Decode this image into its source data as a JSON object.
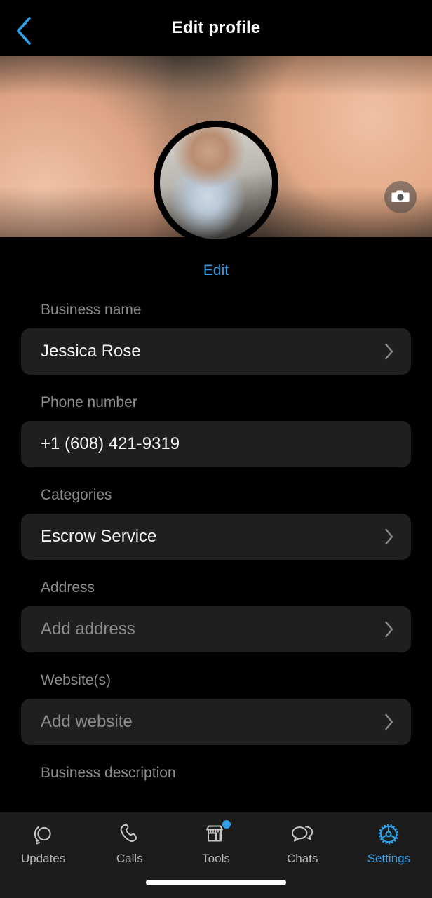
{
  "colors": {
    "accent": "#2f9fe8",
    "background": "#000000",
    "field_background": "#1f1f1f",
    "label_text": "#8d8d8d",
    "value_text": "#f2f2f2",
    "placeholder_text": "#8b8b8b",
    "tabbar_background": "#1c1c1c",
    "tab_inactive": "#b6b6b6",
    "badge": "#2f9fe8"
  },
  "header": {
    "title": "Edit profile",
    "back_icon": "chevron-left-icon"
  },
  "cover": {
    "camera_icon": "camera-icon"
  },
  "profile": {
    "avatar_icon": "avatar-image",
    "edit_label": "Edit"
  },
  "form": {
    "fields": [
      {
        "label": "Business name",
        "value": "Jessica Rose",
        "is_placeholder": false,
        "has_chevron": true,
        "name": "business-name"
      },
      {
        "label": "Phone number",
        "value": "+1 (608) 421-9319",
        "is_placeholder": false,
        "has_chevron": false,
        "name": "phone-number"
      },
      {
        "label": "Categories",
        "value": "Escrow Service",
        "is_placeholder": false,
        "has_chevron": true,
        "name": "categories"
      },
      {
        "label": "Address",
        "value": "Add address",
        "is_placeholder": true,
        "has_chevron": true,
        "name": "address"
      },
      {
        "label": "Website(s)",
        "value": "Add website",
        "is_placeholder": true,
        "has_chevron": true,
        "name": "website"
      }
    ],
    "description_label": "Business description"
  },
  "tabbar": {
    "tabs": [
      {
        "label": "Updates",
        "icon": "updates-icon",
        "active": false,
        "badge": false
      },
      {
        "label": "Calls",
        "icon": "phone-icon",
        "active": false,
        "badge": false
      },
      {
        "label": "Tools",
        "icon": "storefront-icon",
        "active": false,
        "badge": true
      },
      {
        "label": "Chats",
        "icon": "chats-icon",
        "active": false,
        "badge": false
      },
      {
        "label": "Settings",
        "icon": "gear-icon",
        "active": true,
        "badge": false
      }
    ]
  }
}
